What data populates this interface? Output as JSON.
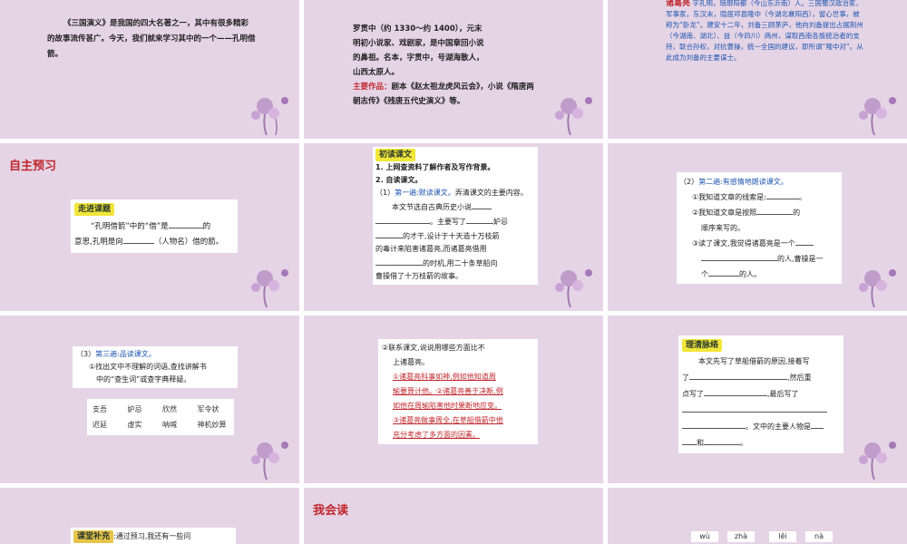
{
  "tile1": {
    "text": "《三国演义》是我国的四大名著之一，其中有很多精彩的故事流传甚广。今天，我们就来学习其中的一个——孔明借箭。"
  },
  "tile2": {
    "line1": "罗贯中（约 1330～约 1400），元末",
    "line2": "明初小说家、戏剧家，是中国章回小说",
    "line3": "的鼻祖。名本，字贯中，号湖海散人，",
    "line4": "山西太原人。",
    "works_label": "主要作品：",
    "works_text": "剧本《赵太祖龙虎风云会》，小说《隋唐两朝志传》《残唐五代史演义》等。"
  },
  "tile3": {
    "name": "诸葛亮",
    "text": "字孔明，琅琊阳都（今山东沂南）人。三国蜀汉政治家、军事家，东汉末，隐居邓县隆中（今湖北襄阳西），留心世事，被称为“卧龙”。建安十二年，刘备三顾茅庐，他向刘备提出占据荆州（今湖南、湖北）、益（今四川）两州，谋取西南各族统治者的支持，联合孙权，对抗曹操，统一全国的建议，即所谓“隆中对”。从此成为刘备的主要谋士。"
  },
  "tile4": {
    "heading": "自主预习",
    "tag": "走进课题",
    "q1": "“孔明借箭”中的“借”是",
    "q2": "的",
    "q3": "意思,孔明是向",
    "q4": "（人物名）借的箭。"
  },
  "tile5": {
    "tag": "初读课文",
    "item1": "1. 上网查资料了解作者及写作背景。",
    "item2": "2. 自读课文。",
    "item3_num": "（1）",
    "item3_blue": "第一遍:默读课文。",
    "item3_text": "弄清课文的主要内容。",
    "p1": "本文节选自古典历史小说",
    "p2": "。主要写了",
    "p3": "妒忌",
    "p4": "的才干,设计于十天造十万枝箭",
    "p5": "的毒计来陷害诸葛亮,而诸葛亮借用",
    "p6": "的时机,用二十条草船向",
    "p7": "曹操借了十万枝箭的故事。"
  },
  "tile6": {
    "num": "（2）",
    "blue": "第二遍:有感情地朗读课文。",
    "l1": "①我知道文章的线索是:",
    "l2": "②我知道文章是按照",
    "l2b": "的",
    "l3": "顺序来写的。",
    "l4": "③读了课文,我觉得诸葛亮是一个",
    "l5": "的人,曹操是一",
    "l6": "个",
    "l6b": "的人。"
  },
  "tile7": {
    "num": "（3）",
    "blue": "第三遍:品读课文。",
    "l1": "①找出文中不理解的词语,查找讲解书",
    "l2": "中的“查生词”或查字典释疑。",
    "words": [
      "支吾",
      "妒忌",
      "欣然",
      "军令状",
      "迟延",
      "虚实",
      "呐喊",
      "神机妙算"
    ]
  },
  "tile8": {
    "l1": "②联系课文,说说用哪些方面比不",
    "l2": "上诸葛亮。",
    "a1": "①诸葛亮科事如神,例如他知道周",
    "a2": "瑜要算计他。②诸葛亮善于决断,例",
    "a3": "如他在周瑜陷害他时果断地应变。",
    "a4": "③诸葛亮做事周全,在草船借箭中他",
    "a5": "充分考虑了多方面的因素。"
  },
  "tile9": {
    "tag": "理清脉络",
    "l1": "本文先写了草船借箭的原因,接着写",
    "l2": "了",
    "l2b": ",然后重",
    "l3": "点写了",
    "l3b": ",最后写了",
    "l5": "。文中的主要人物是",
    "l6": "和",
    "l6b": "。"
  },
  "tile10": {
    "tag": "课堂补充",
    "text": ":通过预习,我还有一些问"
  },
  "tile11": {
    "heading": "我会读"
  },
  "tile12": {
    "pinyin": [
      "wù",
      "zhà",
      "lěi",
      "nà"
    ]
  },
  "colors": {
    "tile_bg": "#e5d4e6",
    "accent_red": "#c0282e",
    "accent_blue": "#1e56b0",
    "tag_yellow": "#f2e63a"
  }
}
